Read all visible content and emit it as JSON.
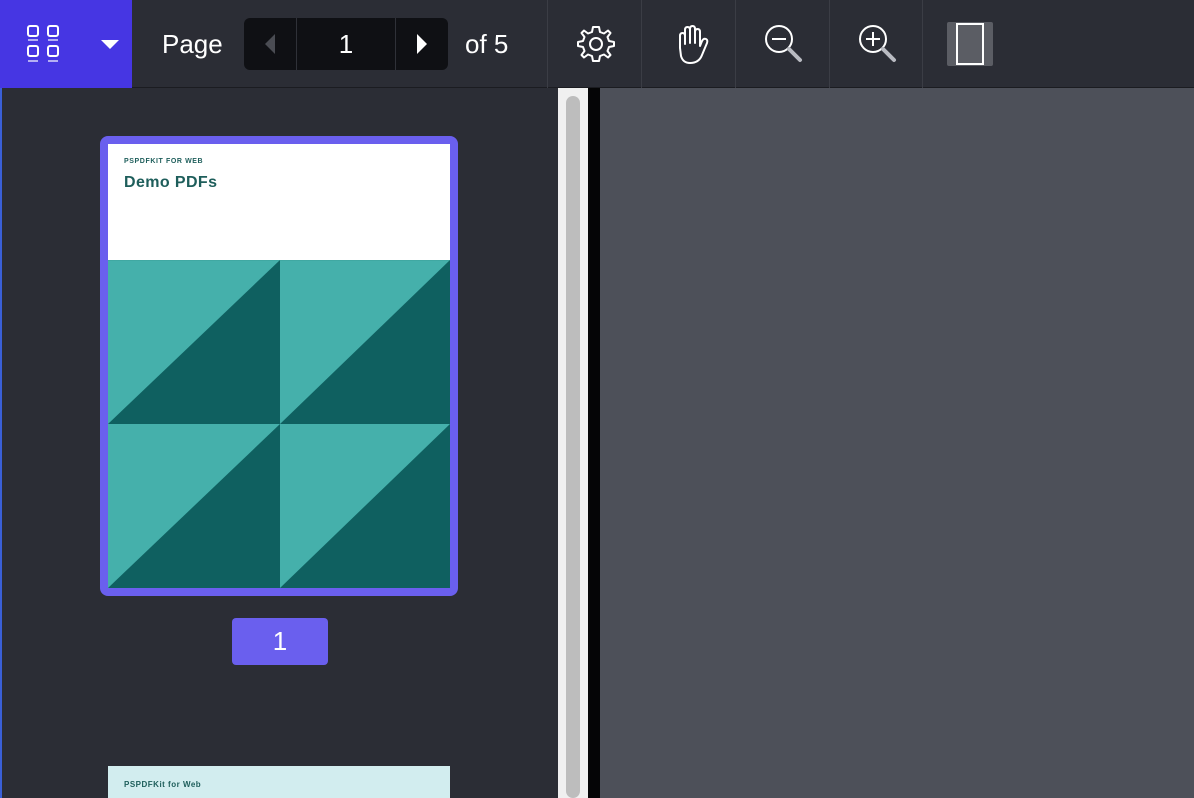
{
  "toolbar": {
    "page_label": "Page",
    "current_page": "1",
    "total_label": "of 5",
    "icons": {
      "sidebar": "thumbnails-grid-icon",
      "dropdown": "chevron-down-icon",
      "prev": "prev-page-icon",
      "next": "next-page-icon",
      "settings": "gear-icon",
      "pan": "hand-icon",
      "zoom_out": "zoom-out-icon",
      "zoom_in": "zoom-in-icon",
      "layout": "single-page-layout-icon"
    }
  },
  "sidebar": {
    "thumbnails": [
      {
        "brand": "PSPDFKIT FOR WEB",
        "title": "Demo PDFs",
        "page_label": "1",
        "selected": true
      },
      {
        "brand": "PSPDFKit for Web"
      }
    ]
  },
  "colors": {
    "accent": "#4636e3",
    "selection": "#6a5fee",
    "teal_light": "#45b0ab",
    "teal_dark": "#0f6060"
  }
}
